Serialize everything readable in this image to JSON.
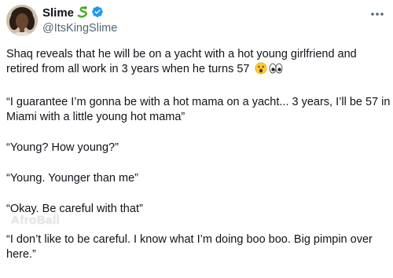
{
  "author": {
    "display_name": "Slime",
    "handle": "@ItsKingSlime",
    "avatar": "avatar",
    "badges": [
      "snake-emoji",
      "verified-badge"
    ]
  },
  "menu": {
    "icon": "more-dots-icon"
  },
  "tweet": {
    "paragraphs": [
      "Shaq reveals that he will be on a yacht with a hot young girlfriend and retired from all work in 3 years when he turns 57",
      "“I guarantee I’m gonna be with a hot mama on a yacht... 3 years, I’ll be 57 in Miami with a little young hot mama”",
      "“Young? How young?”",
      "“Young. Younger than me”",
      "“Okay. Be careful with that”",
      "“I don’t like to be careful. I know what I’m doing boo boo. Big pimpin over here.”"
    ],
    "emojis": [
      "open-mouth-face-emoji",
      "eyes-emoji"
    ]
  },
  "colors": {
    "text": "#0f1419",
    "secondary": "#536471",
    "verified": "#1d9bf0"
  },
  "watermark": {
    "text": "AfroBall"
  }
}
